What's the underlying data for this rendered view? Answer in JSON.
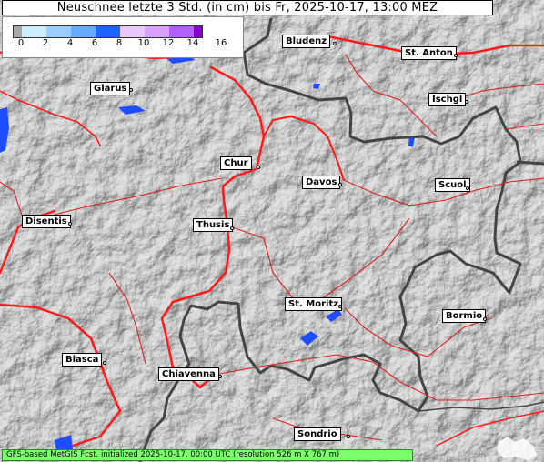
{
  "title": "Neuschnee letzte 3 Std. (in cm) bis Fr, 2025-10-17, 13:00 MEZ",
  "legend": {
    "ticks": [
      "0",
      "2",
      "4",
      "6",
      "8",
      "10",
      "12",
      "14",
      "16"
    ],
    "colors": [
      "#a9a9a9",
      "#cceeff",
      "#99ccff",
      "#66aaff",
      "#1e64ff",
      "#e8c8ff",
      "#d9a0ff",
      "#b060ff",
      "#8800cc"
    ]
  },
  "cities": [
    {
      "name": "Bludenz",
      "slug": "bludenz"
    },
    {
      "name": "St. Anton",
      "slug": "st-anton"
    },
    {
      "name": "Glarus",
      "slug": "glarus"
    },
    {
      "name": "Ischgl",
      "slug": "ischgl"
    },
    {
      "name": "Chur",
      "slug": "chur"
    },
    {
      "name": "Davos",
      "slug": "davos"
    },
    {
      "name": "Scuol",
      "slug": "scuol"
    },
    {
      "name": "Disentis",
      "slug": "disentis"
    },
    {
      "name": "Thusis",
      "slug": "thusis"
    },
    {
      "name": "St. Moritz",
      "slug": "st-moritz"
    },
    {
      "name": "Bormio",
      "slug": "bormio"
    },
    {
      "name": "Biasca",
      "slug": "biasca"
    },
    {
      "name": "Chiavenna",
      "slug": "chiavenna"
    },
    {
      "name": "Sondrio",
      "slug": "sondrio"
    }
  ],
  "footer": "GFS-based MetGIS Fcst, initialized 2025-10-17, 00:00 UTC  (resolution 526 m X 767 m)",
  "colors": {
    "roads": "#ff1a1a",
    "borders": "#444444",
    "water": "#1e4cff",
    "footer_bg": "#7dff6e"
  }
}
